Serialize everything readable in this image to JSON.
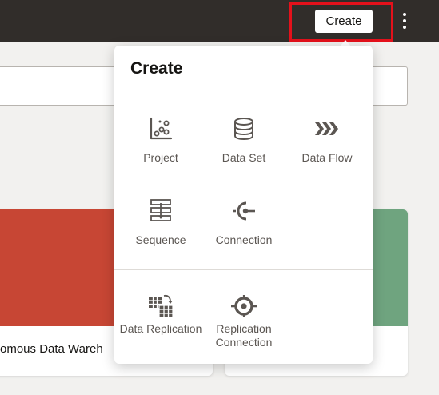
{
  "header": {
    "create_label": "Create"
  },
  "background": {
    "card_title": "omous Data Wareh"
  },
  "create_menu": {
    "title": "Create",
    "items": [
      {
        "label": "Project",
        "icon": "project-scatter-icon"
      },
      {
        "label": "Data Set",
        "icon": "database-icon"
      },
      {
        "label": "Data Flow",
        "icon": "data-flow-chevrons-icon"
      },
      {
        "label": "Sequence",
        "icon": "sequence-icon"
      },
      {
        "label": "Connection",
        "icon": "connection-plug-icon"
      },
      {
        "label": "Data Replication",
        "icon": "data-replication-icon"
      },
      {
        "label": "Replication Connection",
        "icon": "replication-connection-icon"
      }
    ]
  },
  "colors": {
    "topbar": "#312d2a",
    "highlight": "#e4111b",
    "card_red": "#c74634",
    "card_green": "#6fa47f",
    "icon_gray": "#5b5652"
  }
}
